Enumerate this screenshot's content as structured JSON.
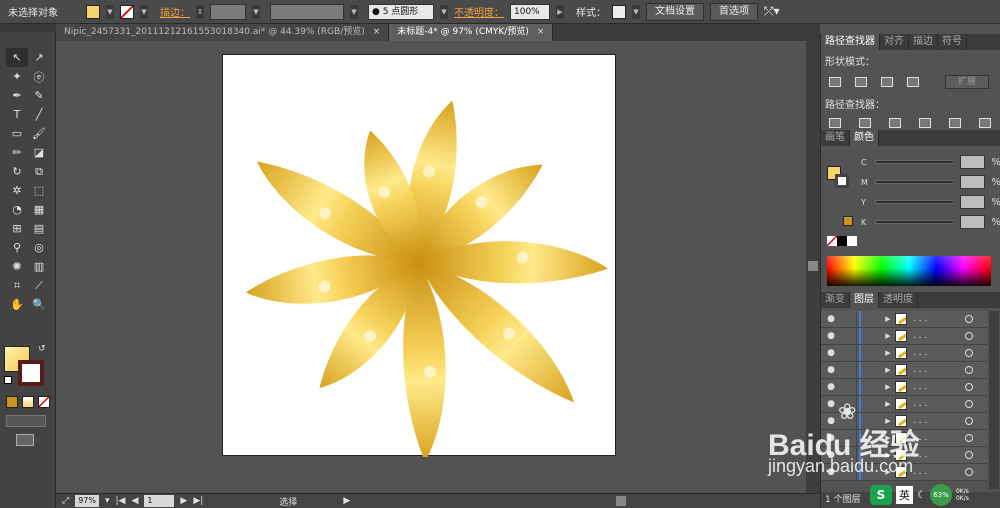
{
  "control_bar": {
    "selection_status": "未选择对象",
    "stroke_label": "描边：",
    "brush_size_label": "5 点圆形",
    "opacity_label": "不透明度：",
    "opacity_value": "100%",
    "style_label": "样式：",
    "doc_settings": "文档设置",
    "preferences": "首选项",
    "fill_color": "#f4d66a",
    "accent_label_color": "#f0a040"
  },
  "document_tabs": [
    {
      "label": "Nipic_2457331_20111212161553018340.ai* @ 44.39% (RGB/预览)",
      "close": "×",
      "active": false
    },
    {
      "label": "未标题-4* @ 97% (CMYK/预览)",
      "close": "×",
      "active": true
    }
  ],
  "tools": [
    {
      "icon": "selection-icon",
      "glyph": "↖"
    },
    {
      "icon": "direct-selection-icon",
      "glyph": "↗"
    },
    {
      "icon": "magic-wand-icon",
      "glyph": "✦"
    },
    {
      "icon": "lasso-icon",
      "glyph": "ⓔ"
    },
    {
      "icon": "pen-icon",
      "glyph": "✒"
    },
    {
      "icon": "curvature-icon",
      "glyph": "✎"
    },
    {
      "icon": "type-icon",
      "glyph": "T"
    },
    {
      "icon": "line-icon",
      "glyph": "╱"
    },
    {
      "icon": "rectangle-icon",
      "glyph": "▭"
    },
    {
      "icon": "paintbrush-icon",
      "glyph": "🖌"
    },
    {
      "icon": "pencil-icon",
      "glyph": "✏"
    },
    {
      "icon": "eraser-icon",
      "glyph": "◪"
    },
    {
      "icon": "rotate-icon",
      "glyph": "↻"
    },
    {
      "icon": "scale-icon",
      "glyph": "⧉"
    },
    {
      "icon": "warp-icon",
      "glyph": "✲"
    },
    {
      "icon": "free-transform-icon",
      "glyph": "⬚"
    },
    {
      "icon": "shape-builder-icon",
      "glyph": "◔"
    },
    {
      "icon": "perspective-grid-icon",
      "glyph": "▦"
    },
    {
      "icon": "mesh-icon",
      "glyph": "⊞"
    },
    {
      "icon": "gradient-icon",
      "glyph": "▤"
    },
    {
      "icon": "eyedropper-icon",
      "glyph": "⚲"
    },
    {
      "icon": "blend-icon",
      "glyph": "◎"
    },
    {
      "icon": "symbol-sprayer-icon",
      "glyph": "✺"
    },
    {
      "icon": "column-graph-icon",
      "glyph": "▥"
    },
    {
      "icon": "artboard-icon",
      "glyph": "⌗"
    },
    {
      "icon": "slice-icon",
      "glyph": "⟋"
    },
    {
      "icon": "hand-icon",
      "glyph": "✋"
    },
    {
      "icon": "zoom-icon",
      "glyph": "🔍"
    }
  ],
  "status_bar": {
    "zoom": "97%",
    "artboard_number": "1",
    "current_tool": "选择"
  },
  "panels": {
    "pathfinder": {
      "tabs": [
        "路径查找器",
        "对齐",
        "描边",
        "符号"
      ],
      "shape_modes_label": "形状模式：",
      "expand_button": "扩展",
      "pathfinders_label": "路径查找器："
    },
    "color": {
      "tabs": [
        "画笔",
        "颜色"
      ],
      "channels": [
        "C",
        "M",
        "Y",
        "K"
      ],
      "percent": "%",
      "fill_color": "#f4d66a",
      "stroke_swatch": "#c8961c"
    },
    "layers": {
      "tabs": [
        "渐变",
        "图层",
        "透明度"
      ],
      "rows": [
        ". . .",
        ". . .",
        ". . .",
        ". . .",
        ". . .",
        ". . .",
        ". . .",
        ". . .",
        ". . .",
        ". . ."
      ],
      "footer": "1 个图层",
      "eye": "●"
    }
  },
  "watermark": {
    "brand": "Baidu 经验",
    "url": "jingyan.baidu.com"
  },
  "tray": {
    "ime": "英",
    "cpu": "63%",
    "net_up": "0K/s",
    "net_down": "0K/s"
  }
}
